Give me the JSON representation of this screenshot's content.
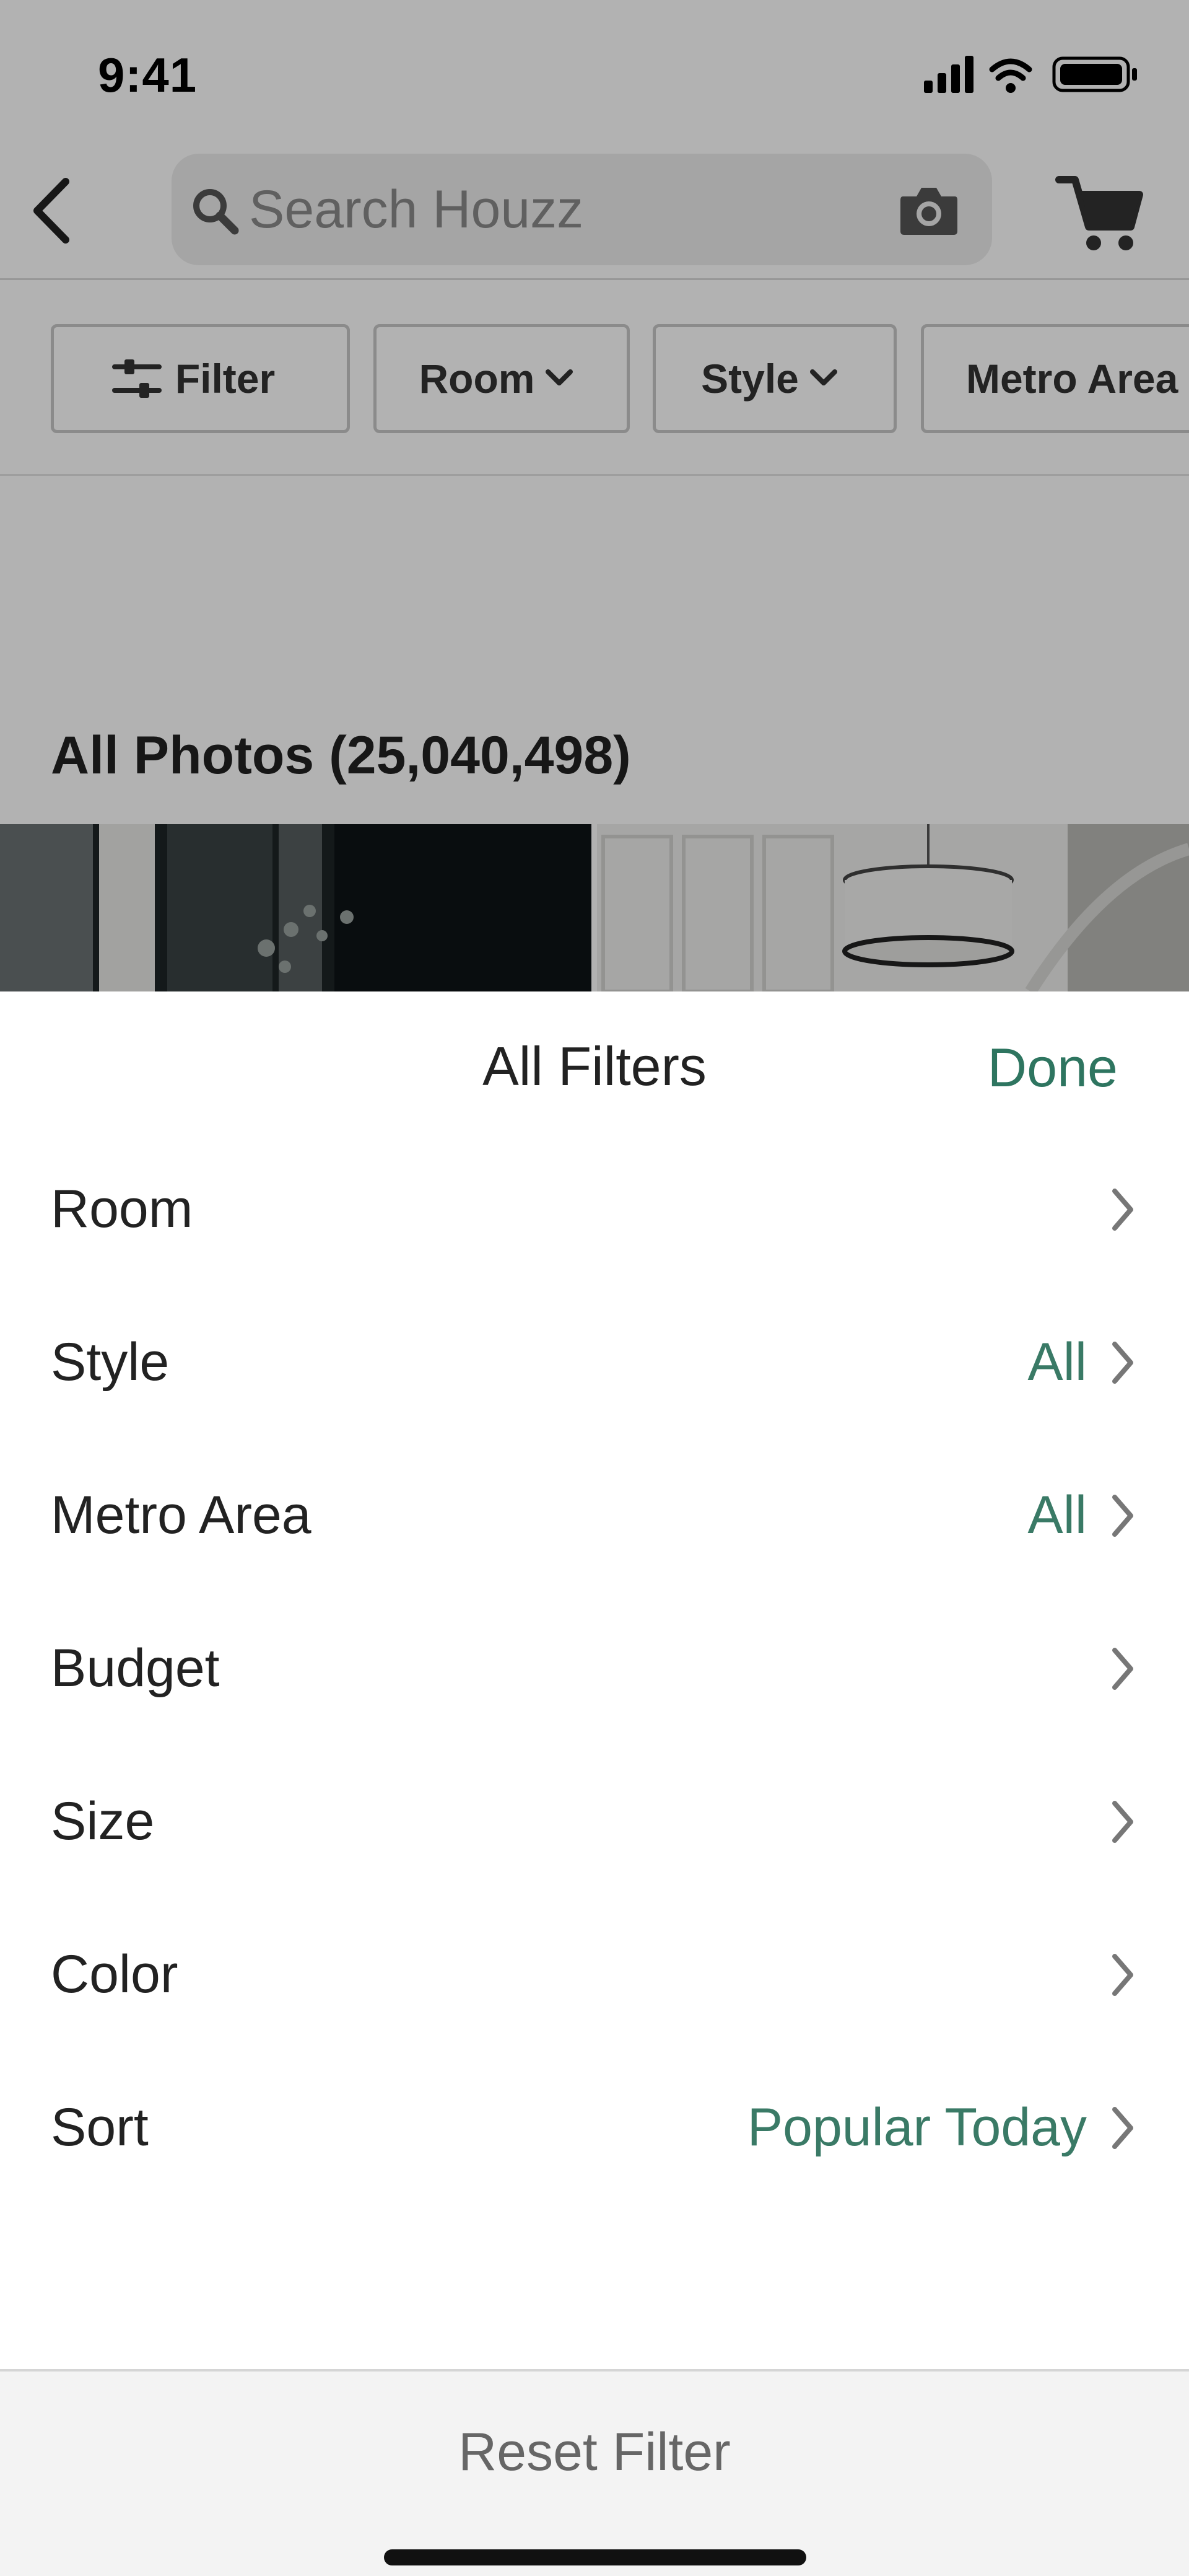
{
  "status_bar": {
    "time": "9:41"
  },
  "search": {
    "placeholder": "Search Houzz"
  },
  "chips": {
    "filter": "Filter",
    "room": "Room",
    "style": "Style",
    "metro": "Metro Area"
  },
  "results": {
    "title": "All Photos (25,040,498)"
  },
  "sheet": {
    "title": "All Filters",
    "done": "Done",
    "rows": [
      {
        "label": "Room",
        "value": ""
      },
      {
        "label": "Style",
        "value": "All"
      },
      {
        "label": "Metro Area",
        "value": "All"
      },
      {
        "label": "Budget",
        "value": ""
      },
      {
        "label": "Size",
        "value": ""
      },
      {
        "label": "Color",
        "value": ""
      },
      {
        "label": "Sort",
        "value": "Popular Today"
      }
    ],
    "reset": "Reset Filter"
  },
  "colors": {
    "accent": "#2e7560",
    "scrim": "rgba(0,0,0,0.30)"
  },
  "icons": [
    "back-chevron-icon",
    "search-icon",
    "camera-icon",
    "cart-icon",
    "sliders-icon",
    "chevron-down-icon",
    "chevron-right-icon",
    "signal-icon",
    "wifi-icon",
    "battery-icon"
  ]
}
